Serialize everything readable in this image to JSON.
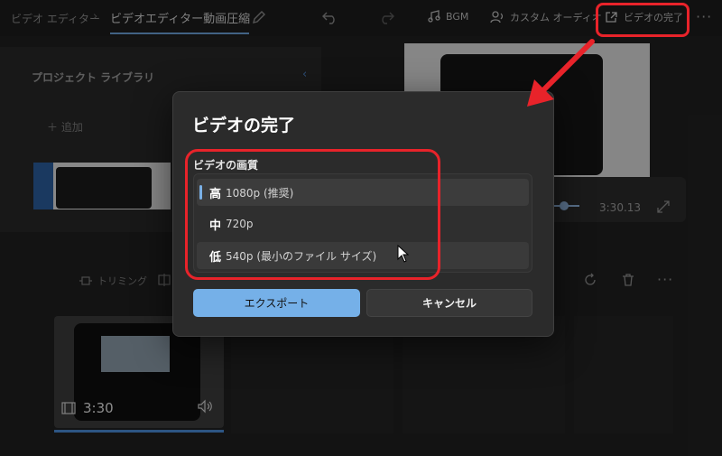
{
  "app": {
    "breadcrumb_root": "ビデオ エディター",
    "breadcrumb_sep": "›",
    "project_title": "ビデオエディター動画圧縮"
  },
  "toolbar": {
    "bgm_label": "BGM",
    "custom_audio_label": "カスタム オーディオ",
    "finish_video_label": "ビデオの完了",
    "more_label": "···"
  },
  "library": {
    "title": "プロジェクト ライブラリ",
    "add_label": "＋ 追加"
  },
  "preview": {
    "time": "3:30.13"
  },
  "storyboard": {
    "trim_label": "トリミング",
    "more_label": "···",
    "clip_duration": "3:30"
  },
  "dialog": {
    "title": "ビデオの完了",
    "quality_label": "ビデオの画質",
    "options": [
      {
        "kanji": "高",
        "text": "1080p (推奨)",
        "selected": true
      },
      {
        "kanji": "中",
        "text": "720p",
        "selected": false
      },
      {
        "kanji": "低",
        "text": "540p (最小のファイル サイズ)",
        "selected": false
      }
    ],
    "export_label": "エクスポート",
    "cancel_label": "キャンセル"
  },
  "colors": {
    "accent": "#75b0e8",
    "annotation_red": "#e8232a",
    "background": "#202020"
  }
}
